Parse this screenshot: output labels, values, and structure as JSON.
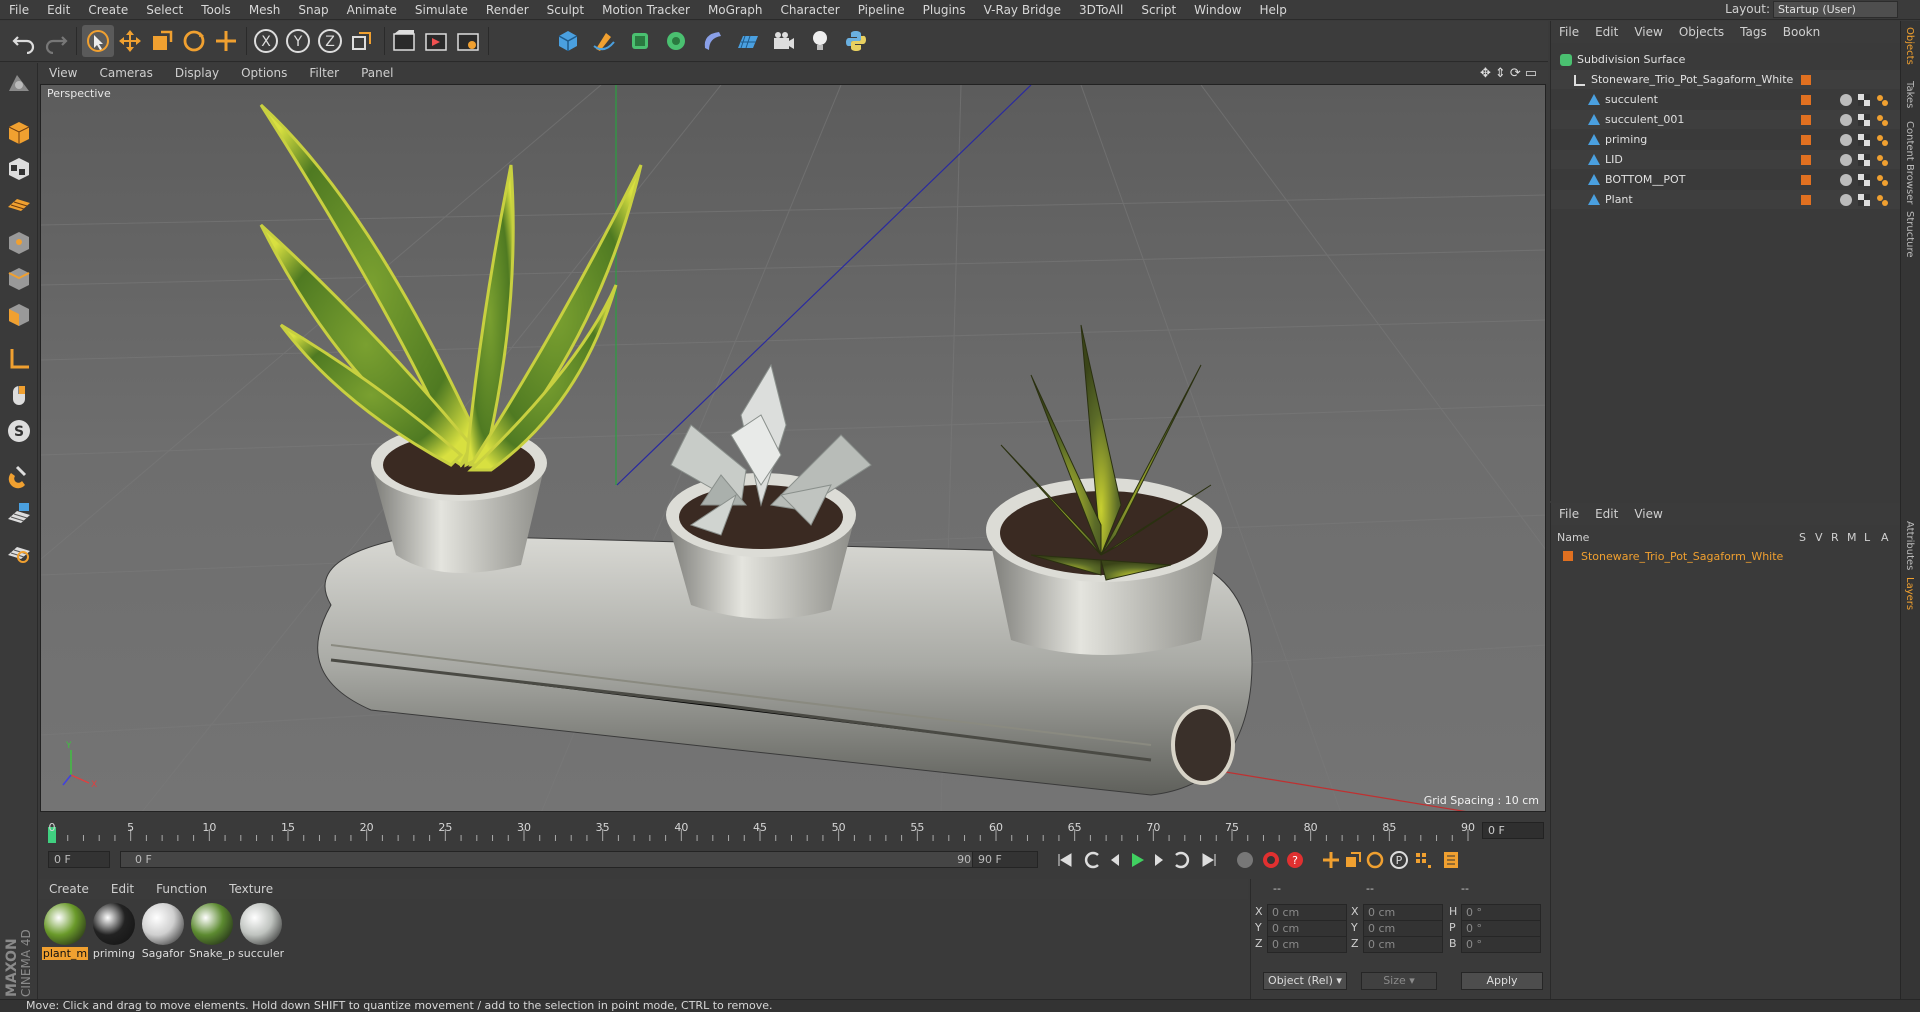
{
  "menubar": {
    "items": [
      "File",
      "Edit",
      "Create",
      "Select",
      "Tools",
      "Mesh",
      "Snap",
      "Animate",
      "Simulate",
      "Render",
      "Sculpt",
      "Motion Tracker",
      "MoGraph",
      "Character",
      "Pipeline",
      "Plugins",
      "V-Ray Bridge",
      "3DToAll",
      "Script",
      "Window",
      "Help"
    ],
    "layout_label": "Layout:",
    "layout_value": "Startup (User)"
  },
  "viewport": {
    "menu": [
      "View",
      "Cameras",
      "Display",
      "Options",
      "Filter",
      "Panel"
    ],
    "label": "Perspective",
    "grid_spacing": "Grid Spacing : 10 cm"
  },
  "timeline": {
    "ticks": [
      "0",
      "5",
      "10",
      "15",
      "20",
      "25",
      "30",
      "35",
      "40",
      "45",
      "50",
      "55",
      "60",
      "65",
      "70",
      "75",
      "80",
      "85",
      "90"
    ],
    "current_frame": "0 F",
    "start_field": "0 F",
    "range_start": "0 F",
    "range_end": "90 F",
    "end_field": "90 F"
  },
  "materials": {
    "menu": [
      "Create",
      "Edit",
      "Function",
      "Texture"
    ],
    "items": [
      {
        "label": "plant_m",
        "color": "#6a9a2a",
        "selected": true
      },
      {
        "label": "priming",
        "color": "#222222",
        "selected": false
      },
      {
        "label": "Sagafor",
        "color": "#cfcfcf",
        "selected": false
      },
      {
        "label": "Snake_p",
        "color": "#5c8a30",
        "selected": false
      },
      {
        "label": "succuler",
        "color": "#bfc3bf",
        "selected": false
      }
    ]
  },
  "coords": {
    "header": [
      "--",
      "--",
      "--"
    ],
    "rows": [
      {
        "a": "X",
        "av": "0 cm",
        "b": "X",
        "bv": "0 cm",
        "c": "H",
        "cv": "0 °"
      },
      {
        "a": "Y",
        "av": "0 cm",
        "b": "Y",
        "bv": "0 cm",
        "c": "P",
        "cv": "0 °"
      },
      {
        "a": "Z",
        "av": "0 cm",
        "b": "Z",
        "bv": "0 cm",
        "c": "B",
        "cv": "0 °"
      }
    ],
    "mode": "Object (Rel)",
    "size": "Size",
    "apply": "Apply"
  },
  "status": "Move: Click and drag to move elements. Hold down SHIFT to quantize movement / add to the selection in point mode, CTRL to remove.",
  "object_manager": {
    "menu": [
      "File",
      "Edit",
      "View",
      "Objects",
      "Tags",
      "Bookn"
    ],
    "objects": [
      {
        "name": "Subdivision Surface",
        "indent": 0
      },
      {
        "name": "Stoneware_Trio_Pot_Sagaform_White",
        "indent": 1
      },
      {
        "name": "succulent",
        "indent": 2
      },
      {
        "name": "succulent_001",
        "indent": 2
      },
      {
        "name": "priming",
        "indent": 2
      },
      {
        "name": "LID",
        "indent": 2
      },
      {
        "name": "BOTTOM__POT",
        "indent": 2
      },
      {
        "name": "Plant",
        "indent": 2
      }
    ]
  },
  "layer_manager": {
    "menu": [
      "File",
      "Edit",
      "View"
    ],
    "columns": [
      "Name",
      "S",
      "V",
      "R",
      "M",
      "L",
      "A"
    ],
    "row": "Stoneware_Trio_Pot_Sagaform_White"
  },
  "right_tabs": [
    "Objects",
    "Takes",
    "Content Browser",
    "Structure",
    "Attributes",
    "Layers"
  ],
  "maxon": {
    "brand": "MAXON",
    "product": "CINEMA 4D"
  }
}
